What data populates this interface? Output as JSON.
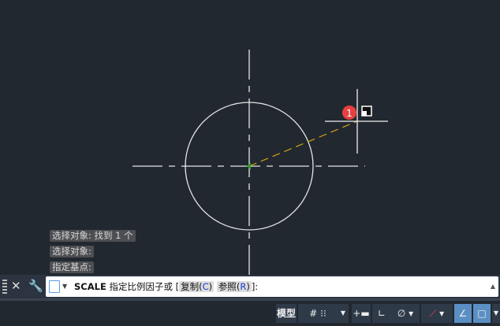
{
  "history": [
    "选择对象: 找到 1 个",
    "选择对象:",
    "指定基点:"
  ],
  "command": {
    "name": "SCALE",
    "prompt": "指定比例因子或",
    "open": "[",
    "options": [
      {
        "label": "复制",
        "key": "C"
      },
      {
        "label": "参照",
        "key": "R"
      }
    ],
    "close": "]:"
  },
  "badge": "1",
  "status": {
    "model": "模型"
  },
  "colors": {
    "background": "#212830",
    "rubberband": "#d4a017",
    "badge": "#e84040"
  }
}
